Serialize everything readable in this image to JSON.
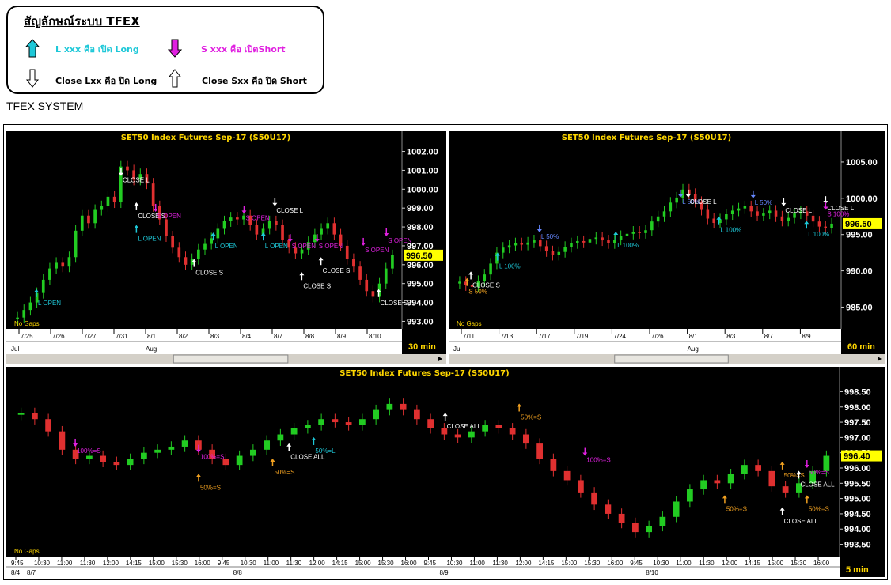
{
  "legend": {
    "title": "สัญลักษณ์ระบบ TFEX",
    "items": [
      {
        "text": "L xxx คือ เปิด Long",
        "color": "#1ec8d8",
        "icon": "arrow-up-filled-icon"
      },
      {
        "text": "S xxx คือ เปิดShort",
        "color": "#e020e0",
        "icon": "arrow-down-filled-icon"
      },
      {
        "text": "Close Lxx คือ ปิด Long",
        "color": "#000000",
        "icon": "arrow-down-outline-icon"
      },
      {
        "text": "Close Sxx คือ ปิด Short",
        "color": "#000000",
        "icon": "arrow-up-outline-icon"
      }
    ]
  },
  "system_title": "TFEX SYSTEM",
  "colors": {
    "up": "#22cc22",
    "down": "#e03030",
    "long": "#1ec8d8",
    "short": "#e020e0",
    "close": "#ffffff",
    "half": "#f0a020",
    "l50": "#6688ff",
    "title": "#ffd700"
  },
  "chart_data": [
    {
      "type": "candlestick",
      "title": "SET50  Index  Futures  Sep-17  (S50U17)",
      "timeframe": "30  min",
      "note": "No Gaps",
      "y_ticks": [
        "1002.00",
        "1001.00",
        "1000.00",
        "999.00",
        "998.00",
        "997.00",
        "996.00",
        "995.00",
        "994.00",
        "993.00"
      ],
      "ylim": [
        992.6,
        1002.4
      ],
      "current_price": "996.50",
      "current_value": 996.5,
      "x_ticks": [
        "7/25",
        "7/26",
        "7/27",
        "7/31",
        "8/1",
        "8/2",
        "8/3",
        "8/4",
        "8/7",
        "8/8",
        "8/9",
        "8/10"
      ],
      "x_months": [
        "Jul",
        "Aug"
      ],
      "closes": [
        993.2,
        993.6,
        994.0,
        994.5,
        995.2,
        995.8,
        996.1,
        995.9,
        996.4,
        997.8,
        998.6,
        998.2,
        998.9,
        999.1,
        999.6,
        999.3,
        1001.2,
        1001.0,
        1000.5,
        1000.8,
        1000.3,
        999.1,
        998.4,
        997.5,
        996.9,
        996.4,
        996.0,
        996.3,
        996.8,
        997.1,
        997.4,
        997.9,
        998.3,
        998.5,
        998.4,
        998.6,
        998.1,
        997.6,
        997.9,
        998.3,
        998.1,
        997.3,
        996.9,
        996.6,
        996.8,
        997.2,
        997.6,
        997.9,
        998.2,
        997.6,
        997.0,
        996.3,
        995.9,
        995.2,
        994.6,
        994.3,
        995.0,
        995.8,
        996.5
      ],
      "annotations": [
        {
          "text": "L  OPEN",
          "kind": "long",
          "x": 0.07,
          "y": 994.2
        },
        {
          "text": "CLOSE  L",
          "kind": "close",
          "x": 0.29,
          "y": 1000.7
        },
        {
          "text": "CLOSE  S",
          "kind": "close",
          "x": 0.33,
          "y": 998.8
        },
        {
          "text": "L OPEN",
          "kind": "long",
          "x": 0.33,
          "y": 997.6
        },
        {
          "text": "S  OPEN",
          "kind": "short",
          "x": 0.38,
          "y": 998.8
        },
        {
          "text": "L  OPEN",
          "kind": "long",
          "x": 0.53,
          "y": 997.2
        },
        {
          "text": "CLOSE  S",
          "kind": "close",
          "x": 0.48,
          "y": 995.8
        },
        {
          "text": "S  OPEN",
          "kind": "short",
          "x": 0.61,
          "y": 998.7
        },
        {
          "text": "L  OPEN",
          "kind": "long",
          "x": 0.66,
          "y": 997.2
        },
        {
          "text": "CLOSE  L",
          "kind": "close",
          "x": 0.69,
          "y": 999.1
        },
        {
          "text": "S  OPEN",
          "kind": "short",
          "x": 0.73,
          "y": 997.2
        },
        {
          "text": "S  OPEN",
          "kind": "short",
          "x": 0.8,
          "y": 997.2
        },
        {
          "text": "CLOSE  S",
          "kind": "close",
          "x": 0.76,
          "y": 995.1
        },
        {
          "text": "CLOSE  S",
          "kind": "close",
          "x": 0.81,
          "y": 995.9
        },
        {
          "text": "S  OPEN",
          "kind": "short",
          "x": 0.92,
          "y": 997.0
        },
        {
          "text": "S  OPEN",
          "kind": "short",
          "x": 0.98,
          "y": 997.5
        },
        {
          "text": "CLOSE  S",
          "kind": "close",
          "x": 0.96,
          "y": 994.2
        }
      ]
    },
    {
      "type": "candlestick",
      "title": "SET50  Index  Futures  Sep-17  (S50U17)",
      "timeframe": "60  min",
      "note": "No Gaps",
      "y_ticks": [
        "1005.00",
        "1000.00",
        "995.00",
        "990.00",
        "985.00"
      ],
      "ylim": [
        982.0,
        1007.5
      ],
      "current_price": "996.50",
      "current_value": 996.5,
      "x_ticks": [
        "7/11",
        "7/13",
        "7/17",
        "7/19",
        "7/24",
        "7/26",
        "8/1",
        "8/3",
        "8/7",
        "8/9"
      ],
      "x_months": [
        "Jul",
        "Aug"
      ],
      "closes": [
        988.5,
        988.0,
        987.8,
        988.6,
        989.5,
        991.0,
        992.5,
        993.2,
        993.5,
        993.8,
        993.6,
        993.9,
        994.2,
        993.4,
        992.7,
        992.2,
        992.6,
        993.3,
        993.8,
        994.1,
        993.9,
        994.4,
        994.6,
        994.2,
        993.8,
        994.3,
        994.8,
        995.1,
        995.4,
        995.2,
        995.6,
        996.8,
        997.5,
        998.2,
        999.4,
        1000.1,
        1001.2,
        1000.6,
        999.5,
        998.4,
        997.2,
        996.6,
        997.1,
        997.8,
        998.3,
        998.6,
        998.9,
        998.2,
        997.6,
        997.9,
        998.3,
        997.5,
        996.9,
        997.3,
        997.9,
        998.2,
        997.6,
        996.8,
        996.1,
        995.9,
        996.5
      ],
      "annotations": [
        {
          "text": "CLOSE  S",
          "kind": "close",
          "x": 0.05,
          "y": 988.6
        },
        {
          "text": "S  50%",
          "kind": "half",
          "x": 0.04,
          "y": 987.7
        },
        {
          "text": "L  100%",
          "kind": "long",
          "x": 0.12,
          "y": 991.2
        },
        {
          "text": "L  50%",
          "kind": "l50",
          "x": 0.23,
          "y": 995.3
        },
        {
          "text": "L  100%",
          "kind": "long",
          "x": 0.43,
          "y": 994.1
        },
        {
          "text": "L  50%",
          "kind": "l50",
          "x": 0.6,
          "y": 1000.1
        },
        {
          "text": "CLOSE  L",
          "kind": "close",
          "x": 0.62,
          "y": 1000.1
        },
        {
          "text": "L  100%",
          "kind": "long",
          "x": 0.7,
          "y": 996.2
        },
        {
          "text": "L  50%",
          "kind": "l50",
          "x": 0.79,
          "y": 1000.0
        },
        {
          "text": "CLOSE  L",
          "kind": "close",
          "x": 0.87,
          "y": 998.9
        },
        {
          "text": "L  100%",
          "kind": "long",
          "x": 0.93,
          "y": 995.6
        },
        {
          "text": "CLOSE  L",
          "kind": "close",
          "x": 0.98,
          "y": 999.2
        },
        {
          "text": "S  100%",
          "kind": "short",
          "x": 0.98,
          "y": 998.4
        }
      ]
    },
    {
      "type": "candlestick",
      "title": "SET50  Index  Futures  Sep-17  (S50U17)",
      "timeframe": "5  min",
      "note": "No Gaps",
      "y_ticks": [
        "998.50",
        "998.00",
        "997.50",
        "997.00",
        "996.50",
        "996.00",
        "995.50",
        "995.00",
        "994.50",
        "994.00",
        "993.50"
      ],
      "ylim": [
        993.1,
        998.9
      ],
      "current_price": "996.40",
      "current_value": 996.4,
      "x_ticks": [
        "9:45",
        "10:30",
        "11:00",
        "11:30",
        "12:00",
        "14:15",
        "15:00",
        "15:30",
        "16:00"
      ],
      "x_dates": [
        "8/4",
        "8/7",
        "8/8",
        "8/9",
        "8/10"
      ],
      "closes": [
        997.8,
        997.6,
        997.2,
        996.6,
        996.3,
        996.4,
        996.2,
        996.1,
        996.3,
        996.5,
        996.6,
        996.7,
        996.9,
        996.6,
        996.3,
        996.1,
        996.4,
        996.6,
        996.9,
        997.1,
        997.3,
        997.4,
        997.6,
        997.5,
        997.4,
        997.6,
        997.9,
        998.1,
        997.9,
        997.6,
        997.3,
        997.1,
        997.0,
        997.2,
        997.4,
        997.3,
        997.1,
        996.8,
        996.3,
        995.9,
        995.6,
        995.2,
        994.8,
        994.5,
        994.2,
        993.9,
        994.1,
        994.4,
        994.9,
        995.3,
        995.6,
        995.5,
        995.8,
        996.1,
        995.9,
        995.4,
        995.2,
        995.5,
        995.9,
        996.4
      ],
      "annotations": [
        {
          "text": "100%=S",
          "kind": "short",
          "x": 0.08,
          "y": 996.7
        },
        {
          "text": "100%=S",
          "kind": "short",
          "x": 0.23,
          "y": 996.5
        },
        {
          "text": "50%=S",
          "kind": "half",
          "x": 0.23,
          "y": 995.5
        },
        {
          "text": "50%=S",
          "kind": "half",
          "x": 0.32,
          "y": 996.0
        },
        {
          "text": "CLOSE  ALL",
          "kind": "close",
          "x": 0.34,
          "y": 996.5
        },
        {
          "text": "50%=L",
          "kind": "long",
          "x": 0.37,
          "y": 996.7
        },
        {
          "text": "CLOSE  ALL",
          "kind": "close",
          "x": 0.53,
          "y": 997.5
        },
        {
          "text": "50%=S",
          "kind": "half",
          "x": 0.62,
          "y": 997.8
        },
        {
          "text": "100%=S",
          "kind": "short",
          "x": 0.7,
          "y": 996.4
        },
        {
          "text": "50%=S",
          "kind": "half",
          "x": 0.87,
          "y": 994.8
        },
        {
          "text": "CLOSE  ALL",
          "kind": "close",
          "x": 0.94,
          "y": 994.4
        },
        {
          "text": "50%=S",
          "kind": "half",
          "x": 0.94,
          "y": 995.9
        },
        {
          "text": "CLOSE  ALL",
          "kind": "close",
          "x": 0.96,
          "y": 995.6
        },
        {
          "text": "50%=S",
          "kind": "half",
          "x": 0.97,
          "y": 994.8
        },
        {
          "text": "50%=S",
          "kind": "short",
          "x": 0.97,
          "y": 996.0
        }
      ]
    }
  ]
}
